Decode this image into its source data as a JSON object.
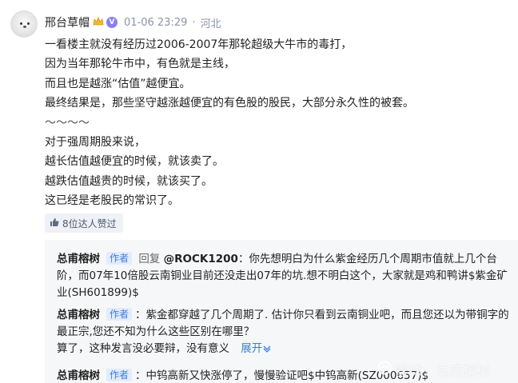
{
  "post": {
    "username": "邢台草帽",
    "timestamp": "01-06 23:29",
    "separator": "·",
    "location": "河北",
    "verified_mark": "V",
    "lines": [
      "一看楼主就没有经历过2006-2007年那轮超级大牛市的毒打，",
      "因为当年那轮牛市中，有色就是主线，",
      "而且也是越涨“估值”越便宜。",
      "最终结果是，那些坚守越涨越便宜的有色股的股民，大部分永久性的被套。",
      "～～～～",
      "对于强周期股来说，",
      "越长估值越便宜的时候，就该卖了。",
      "越跌估值越贵的时候，就该买了。",
      "这已经是老股民的常识了。"
    ],
    "likes_label": "8位达人赞过"
  },
  "comments": [
    {
      "author": "总甫榕树",
      "tag": "作者",
      "reply_word": "回复",
      "mention": "@ROCK1200",
      "text": "：你先想明白为什么紫金经历几个周期市值就上几个台阶，而07年10倍股云南铜业目前还没走出07年的坑.想不明白这个，大家就是鸡和鸭讲$紫金矿业(SH601899)$"
    },
    {
      "author": "总甫榕树",
      "tag": "作者",
      "text": "：紫金都穿越了几个周期了. 估计你只看到云南铜业吧，而且您还以为带铜字的最正宗,您还不知为什么这些区别在哪里？",
      "text2": "算了，这种发言没必要辩，没有意义",
      "expand": "展开"
    },
    {
      "author": "总甫榕树",
      "tag": "作者",
      "text": "：中钨高新又快涨停了，慢慢验证吧$中钨高新(SZ000657)$"
    }
  ],
  "watermark": "雪球：总甫榕树",
  "colors": {
    "link_blue": "#3a7de0",
    "meta_gray": "#8a94a6",
    "badge_purple": "#8a7ef2",
    "panel_bg": "#f6f7f9"
  },
  "icons": [
    "avatar",
    "crown-icon",
    "verified-icon",
    "thumbs-up-icon",
    "chevron-down-icon",
    "snowball-logo-icon"
  ]
}
